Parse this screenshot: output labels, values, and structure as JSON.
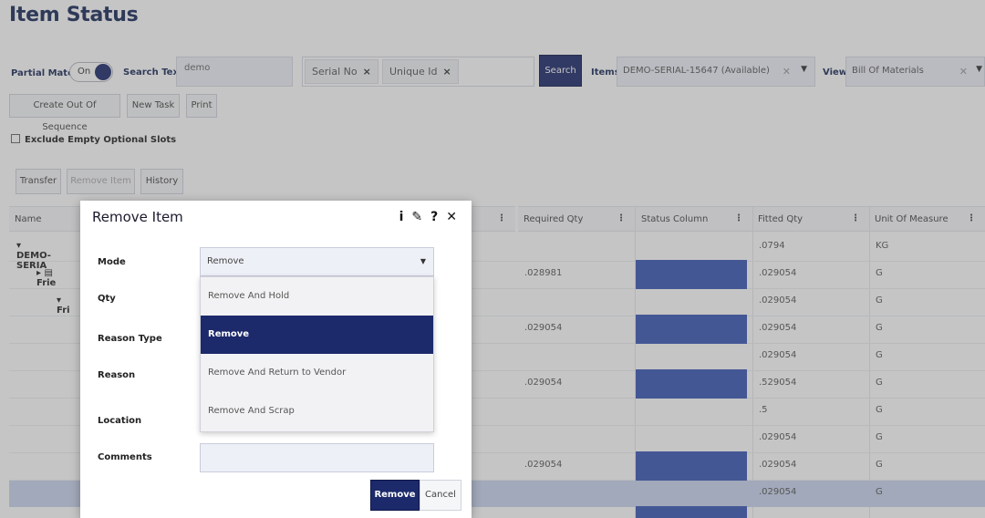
{
  "page": {
    "title": "Item Status"
  },
  "search": {
    "partial_match_label": "Partial Match",
    "toggle_value": "On",
    "search_text_label": "Search Text",
    "search_text_value": "demo",
    "chips": [
      "Serial No",
      "Unique Id"
    ],
    "search_button": "Search",
    "items_label": "Items",
    "items_value": "DEMO-SERIAL-15647 (Available)",
    "view_label": "View",
    "view_value": "Bill Of Materials"
  },
  "toolbar": {
    "create_out_of_sequence": "Create Out Of Sequence",
    "new_task": "New Task",
    "print": "Print",
    "exclude_empty": "Exclude Empty Optional Slots",
    "transfer": "Transfer",
    "remove_item": "Remove Item",
    "history": "History"
  },
  "grid": {
    "columns": [
      "Name",
      "Required Qty",
      "Status Column",
      "Fitted Qty",
      "Unit Of Measure"
    ],
    "rows": [
      {
        "name": "DEMO-SERIA",
        "required": "",
        "fitted": ".0794",
        "uom": "KG",
        "status": false
      },
      {
        "name": "Frie",
        "required": ".028981",
        "fitted": ".029054",
        "uom": "G",
        "status": true
      },
      {
        "name": "Fri",
        "required": "",
        "fitted": ".029054",
        "uom": "G",
        "status": false
      },
      {
        "name": "",
        "required": ".029054",
        "fitted": ".029054",
        "uom": "G",
        "status": true
      },
      {
        "name": "",
        "required": "",
        "fitted": ".029054",
        "uom": "G",
        "status": false
      },
      {
        "name": "",
        "required": ".029054",
        "fitted": ".529054",
        "uom": "G",
        "status": true
      },
      {
        "name": "",
        "required": "",
        "fitted": ".5",
        "uom": "G",
        "status": false
      },
      {
        "name": "",
        "required": "",
        "fitted": ".029054",
        "uom": "G",
        "status": false
      },
      {
        "name": "",
        "required": ".029054",
        "fitted": ".029054",
        "uom": "G",
        "status": true
      },
      {
        "name": "",
        "required": "",
        "fitted": ".029054",
        "uom": "G",
        "status": false
      }
    ]
  },
  "modal": {
    "title": "Remove Item",
    "icons": [
      "info-icon",
      "edit-icon",
      "help-icon",
      "close-icon"
    ],
    "labels": {
      "mode": "Mode",
      "qty": "Qty",
      "reason_type": "Reason Type",
      "reason": "Reason",
      "location": "Location",
      "comments": "Comments"
    },
    "mode_value": "Remove",
    "options": [
      "Remove And Hold",
      "Remove",
      "Remove And Return to Vendor",
      "Remove And Scrap"
    ],
    "selected_option": "Remove",
    "remove_button": "Remove",
    "cancel_button": "Cancel"
  }
}
